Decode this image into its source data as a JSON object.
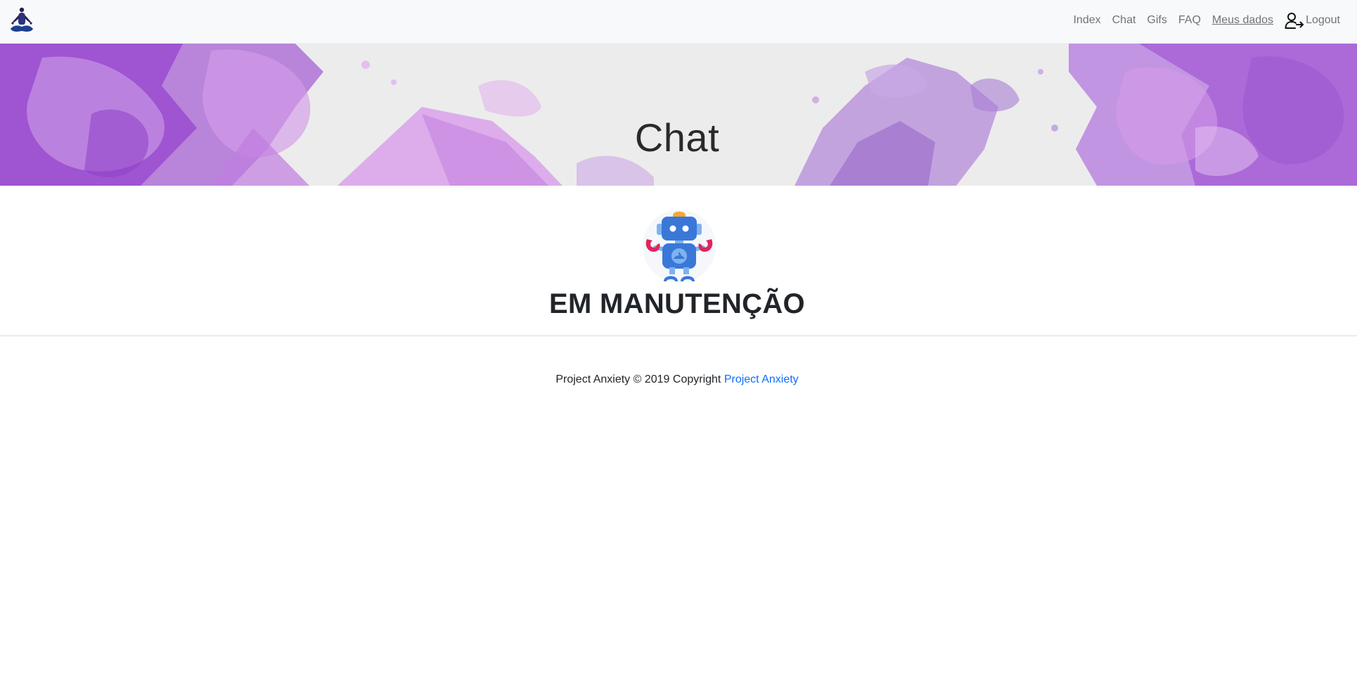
{
  "navbar": {
    "brand_icon": "meditation-logo-icon",
    "links": [
      {
        "label": "Index"
      },
      {
        "label": "Chat"
      },
      {
        "label": "Gifs"
      },
      {
        "label": "FAQ"
      },
      {
        "label": "Meus dados"
      },
      {
        "label": "Logout",
        "icon": "logout-user-icon"
      }
    ]
  },
  "hero": {
    "title": "Chat",
    "background": "purple-watercolor-splash"
  },
  "main": {
    "illustration": "robot-icon",
    "heading": "EM MANUTENÇÃO"
  },
  "footer": {
    "text": "Project Anxiety © 2019 Copyright",
    "link_label": "Project Anxiety"
  },
  "colors": {
    "navbar_bg": "#f8f9fa",
    "link_muted": "#8c8c8c",
    "link_primary": "#0d6efd",
    "hero_purple": "#a45ed6",
    "robot_blue": "#3a78d8",
    "robot_red": "#e0245e",
    "robot_orange": "#f4a931"
  }
}
